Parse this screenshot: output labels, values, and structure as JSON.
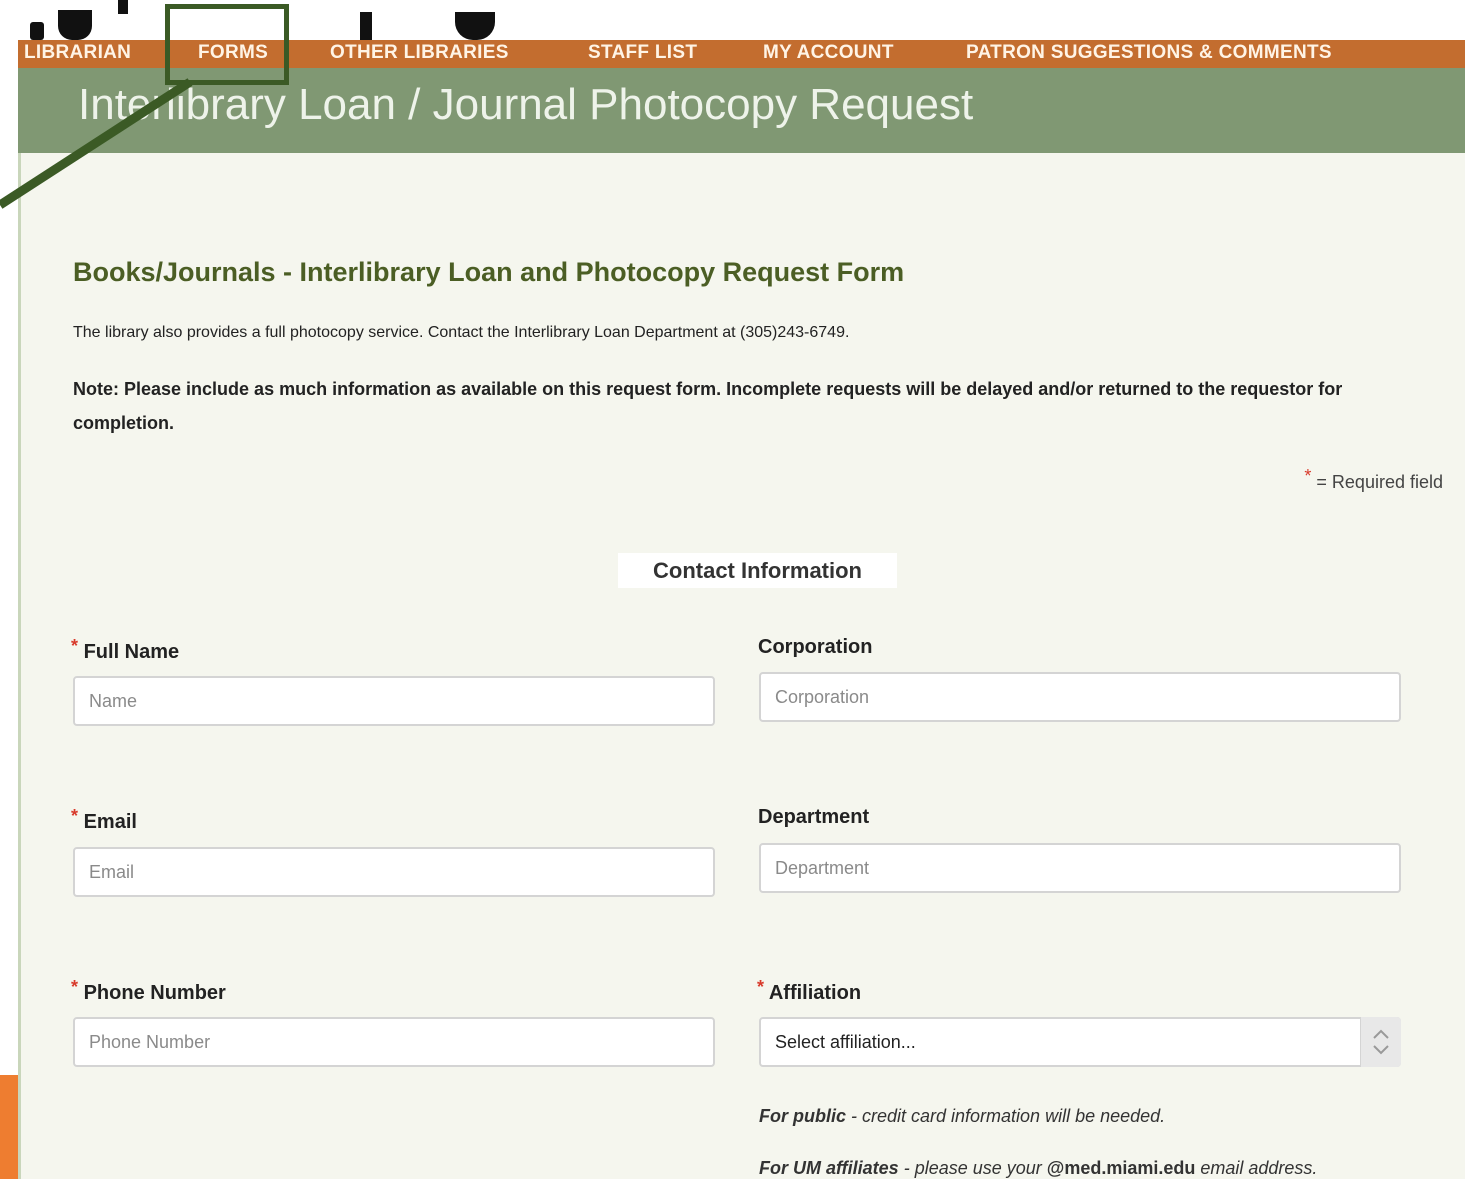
{
  "nav": {
    "items": [
      {
        "label": "LIBRARIAN"
      },
      {
        "label": "FORMS"
      },
      {
        "label": "OTHER LIBRARIES"
      },
      {
        "label": "STAFF LIST"
      },
      {
        "label": "MY ACCOUNT"
      },
      {
        "label": "PATRON SUGGESTIONS & COMMENTS"
      }
    ]
  },
  "banner": {
    "title": "Interlibrary Loan / Journal Photocopy Request"
  },
  "form": {
    "title": "Books/Journals - Interlibrary Loan and Photocopy Request Form",
    "intro": "The library also provides a full photocopy service. Contact the Interlibrary Loan Department at (305)243-6749.",
    "note": "Note: Please include as much information as available on this request form. Incomplete requests will be delayed and/or returned to the requestor for completion.",
    "required_legend_star": "*",
    "required_legend_text": "= Required field",
    "section_heading": "Contact Information",
    "fields": {
      "full_name": {
        "label": "Full Name",
        "placeholder": "Name",
        "required_mark": "*"
      },
      "corporation": {
        "label": "Corporation",
        "placeholder": "Corporation"
      },
      "email": {
        "label": "Email",
        "placeholder": "Email",
        "required_mark": "*"
      },
      "department": {
        "label": "Department",
        "placeholder": "Department"
      },
      "phone": {
        "label": "Phone Number",
        "placeholder": "Phone Number",
        "required_mark": "*"
      },
      "affiliation": {
        "label": "Affiliation",
        "selected": "Select affiliation...",
        "required_mark": "*"
      }
    },
    "hints": {
      "public_bold": "For public",
      "public_text": " - credit card information will be needed.",
      "um_bold": "For UM affiliates",
      "um_text": " - please use your ",
      "um_email": "@med.miami.edu",
      "um_tail": " email address."
    }
  },
  "colors": {
    "nav_bg": "#c36d2f",
    "banner_bg": "#809873",
    "content_bg": "#f5f6ee",
    "highlight": "#3b5a25",
    "required": "#d83a2b",
    "title_green": "#4b5e24"
  }
}
